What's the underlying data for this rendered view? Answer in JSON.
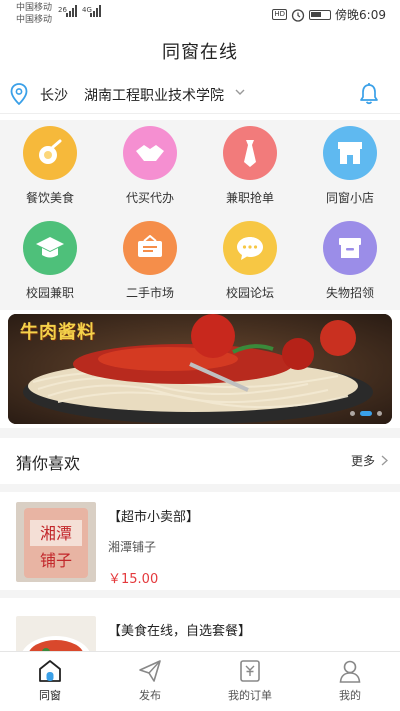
{
  "status_bar": {
    "carrier1": "中国移动",
    "carrier2": "中国移动",
    "signal1": "26",
    "signal2": "4G",
    "badge": "HD",
    "time": "傍晚6:09"
  },
  "header": {
    "title": "同窗在线"
  },
  "location": {
    "city": "长沙",
    "school": "湖南工程职业技术学院"
  },
  "grid": [
    {
      "label": "餐饮美食",
      "icon": "food-icon",
      "color": "#f6b93b"
    },
    {
      "label": "代买代办",
      "icon": "handshake-icon",
      "color": "#f58fd1"
    },
    {
      "label": "兼职抢单",
      "icon": "tie-icon",
      "color": "#f27b7b"
    },
    {
      "label": "同窗小店",
      "icon": "shop-icon",
      "color": "#5fb9f0"
    },
    {
      "label": "校园兼职",
      "icon": "graduation-cap-icon",
      "color": "#4ec07a"
    },
    {
      "label": "二手市场",
      "icon": "secondhand-icon",
      "color": "#f58e4a"
    },
    {
      "label": "校园论坛",
      "icon": "chat-icon",
      "color": "#f7c744"
    },
    {
      "label": "失物招领",
      "icon": "box-icon",
      "color": "#9b8de8"
    }
  ],
  "banner": {
    "text": "牛肉酱料"
  },
  "section": {
    "title": "猜你喜欢",
    "more": "更多"
  },
  "products": [
    {
      "name": "【超市小卖部】",
      "shop": "湘潭铺子",
      "price": "￥15.00"
    },
    {
      "name": "【美食在线，自选套餐】",
      "shop": "",
      "price": ""
    }
  ],
  "tabs": [
    {
      "label": "同窗",
      "icon": "home-icon",
      "active": true
    },
    {
      "label": "发布",
      "icon": "send-icon",
      "active": false
    },
    {
      "label": "我的订单",
      "icon": "order-icon",
      "active": false
    },
    {
      "label": "我的",
      "icon": "user-icon",
      "active": false
    }
  ],
  "colors": {
    "accent": "#3aa0e8",
    "price": "#e4393c"
  }
}
